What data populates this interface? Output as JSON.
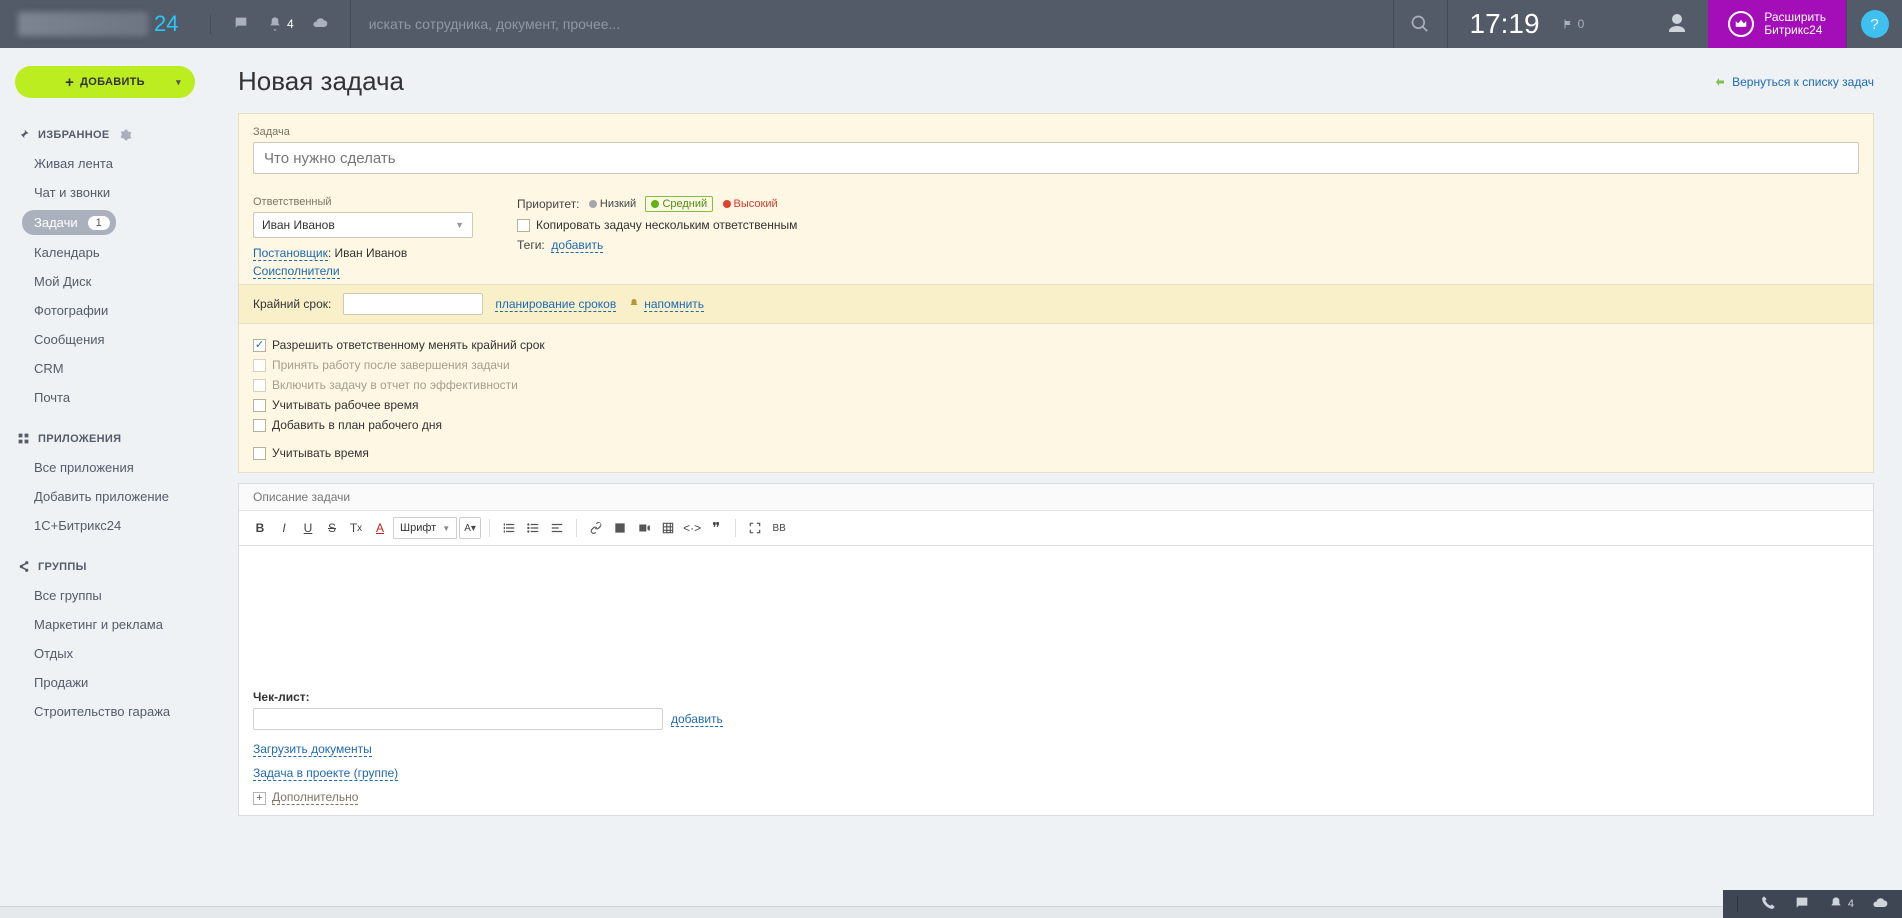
{
  "header": {
    "logo_suffix": "24",
    "search_placeholder": "искать сотрудника, документ, прочее...",
    "notif_count": "4",
    "clock": "17:19",
    "flag_count": "0",
    "expand_line1": "Расширить",
    "expand_line2": "Битрикс24",
    "help": "?"
  },
  "sidebar": {
    "add_label": "ДОБАВИТЬ",
    "sections": {
      "fav": {
        "title": "ИЗБРАННОЕ"
      },
      "apps": {
        "title": "ПРИЛОЖЕНИЯ"
      },
      "groups": {
        "title": "ГРУППЫ"
      }
    },
    "fav_items": [
      "Живая лента",
      "Чат и звонки",
      "Задачи",
      "Календарь",
      "Мой Диск",
      "Фотографии",
      "Сообщения",
      "CRM",
      "Почта"
    ],
    "tasks_badge": "1",
    "apps_items": [
      "Все приложения",
      "Добавить приложение",
      "1С+Битрикс24"
    ],
    "groups_items": [
      "Все группы",
      "Маркетинг и реклама",
      "Отдых",
      "Продажи",
      "Строительство гаража"
    ]
  },
  "page": {
    "title": "Новая задача",
    "back": "Вернуться к списку задач"
  },
  "form": {
    "task_label": "Задача",
    "task_placeholder": "Что нужно сделать",
    "responsible_label": "Ответственный",
    "responsible_value": "Иван Иванов",
    "setter_label": "Постановщик",
    "setter_value": "Иван Иванов",
    "coexec": "Соисполнители",
    "priority_label": "Приоритет:",
    "prio_low": "Низкий",
    "prio_mid": "Средний",
    "prio_high": "Высокий",
    "copy_checkbox": "Копировать задачу нескольким ответственным",
    "tags_label": "Теги:",
    "tags_add": "добавить",
    "deadline_label": "Крайний срок:",
    "deadline_plan": "планирование сроков",
    "deadline_remind": "напомнить",
    "chk1": "Разрешить ответственному менять крайний срок",
    "chk2": "Принять работу после завершения задачи",
    "chk3": "Включить задачу в отчет по эффективности",
    "chk4": "Учитывать рабочее время",
    "chk5": "Добавить в план рабочего дня",
    "chk6": "Учитывать время"
  },
  "desc": {
    "label": "Описание задачи",
    "font_sel": "Шрифт"
  },
  "checklist": {
    "label": "Чек-лист:",
    "add": "добавить",
    "upload": "Загрузить документы",
    "project": "Задача в проекте (группе)",
    "more": "Дополнительно"
  },
  "bottombar": {
    "notif": "4"
  }
}
